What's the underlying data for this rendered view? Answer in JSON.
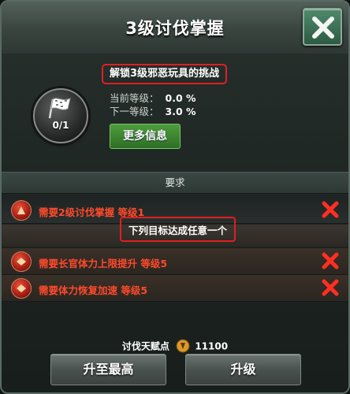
{
  "dialog": {
    "title": "3级讨伐掌握",
    "close_icon": "close-x-icon"
  },
  "skill": {
    "badge_icon": "flag-icon",
    "progress": "0/1",
    "unlock_text": "解锁3级邪恶玩具的挑战",
    "current_level_label": "当前等级：",
    "current_level_value": "0.0 %",
    "next_level_label": "下一等级：",
    "next_level_value": "3.0 %",
    "more_info_label": "更多信息"
  },
  "requirements": {
    "header": "要求",
    "any_goal_label": "下列目标达成任意一个",
    "items": [
      {
        "text": "需要2级讨伐掌握 等级1",
        "icon": "skill-icon",
        "status_icon": "red-x-icon"
      },
      {
        "text": "需要长官体力上限提升 等级5",
        "icon": "skill-icon",
        "status_icon": "red-x-icon"
      },
      {
        "text": "需要体力恢复加速 等级5",
        "icon": "skill-icon",
        "status_icon": "red-x-icon"
      }
    ]
  },
  "points": {
    "label": "讨伐天赋点",
    "value": "11100",
    "icon": "talent-point-icon"
  },
  "buttons": {
    "max_label": "升至最高",
    "upgrade_label": "升级"
  },
  "colors": {
    "requirement_text": "#ff4a2b",
    "highlight_border": "#e02020",
    "more_info_green": "#4e9c3e",
    "close_button_green": "#4f8a6b"
  }
}
